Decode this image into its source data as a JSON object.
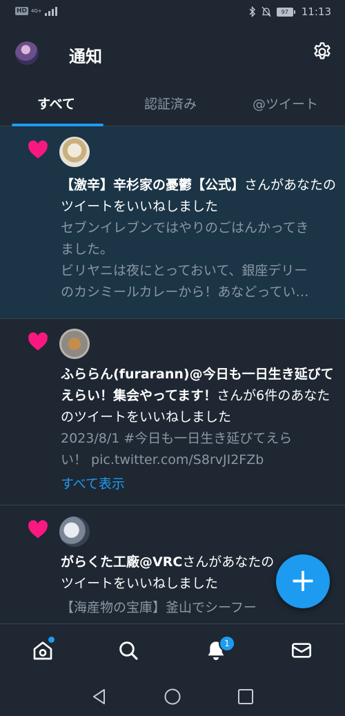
{
  "status_bar": {
    "hd": "HD",
    "network": "4G+",
    "battery": "97",
    "time": "11:13"
  },
  "header": {
    "title": "通知"
  },
  "tabs": [
    {
      "label": "すべて",
      "active": true
    },
    {
      "label": "認証済み",
      "active": false
    },
    {
      "label": "@ツイート",
      "active": false
    }
  ],
  "notifications": [
    {
      "type": "like",
      "unread": true,
      "name": "【激辛】辛杉家の憂鬱【公式】",
      "action": "さんがあなたのツイートをいいねしました",
      "snippet_lines": [
        "セブンイレブンではやりのごはんかってき",
        "ました。",
        "ビリヤニは夜にとっておいて、銀座デリー",
        "のカシミールカレーから！あなどってい…"
      ]
    },
    {
      "type": "like",
      "unread": false,
      "name": "ふららん(furarann)@今日も一日生き延びてえらい！集会やってます！",
      "action": "さんが6件のあなたのツイートをいいねしました",
      "snippet_lines": [
        "2023/8/1 #今日も一日生き延びてえら",
        "い！ pic.twitter.com/S8rvJI2FZb"
      ],
      "show_all": "すべて表示"
    },
    {
      "type": "like",
      "unread": false,
      "name": "がらくた工廠@VRC",
      "action": "さんがあなたのツイートをいいねしました",
      "snippet_lines": [
        "【海産物の宝庫】釜山でシーフー"
      ]
    }
  ],
  "fab": {
    "label": "+"
  },
  "bottom_nav": {
    "notifications_badge": "1"
  },
  "colors": {
    "background": "#1e2732",
    "unread_background": "#1b3446",
    "accent": "#1d9bf0",
    "like": "#f91880",
    "secondary_text": "#8b98a5"
  }
}
